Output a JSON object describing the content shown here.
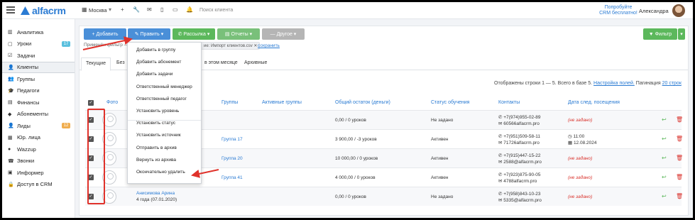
{
  "topbar": {
    "brand": "alfacrm",
    "city": "Москва",
    "search_placeholder": "Поиск клиента",
    "promo_line1": "Попробуйте",
    "promo_line2": "CRM бесплатно!",
    "user_name": "Александра"
  },
  "sidebar": {
    "items": [
      {
        "icon": "chart-icon",
        "glyph": "▥",
        "label": "Аналитика"
      },
      {
        "icon": "calendar-icon",
        "glyph": "▢",
        "label": "Уроки",
        "badge": "17",
        "badge_color": "#5bc0de"
      },
      {
        "icon": "tasks-icon",
        "glyph": "☑",
        "label": "Задачи"
      },
      {
        "icon": "user-icon",
        "glyph": "👤",
        "label": "Клиенты",
        "active": true
      },
      {
        "icon": "users-icon",
        "glyph": "👥",
        "label": "Группы"
      },
      {
        "icon": "graduation-icon",
        "glyph": "🎓",
        "label": "Педагоги"
      },
      {
        "icon": "finance-icon",
        "glyph": "▤",
        "label": "Финансы"
      },
      {
        "icon": "ticket-icon",
        "glyph": "◆",
        "label": "Абонементы"
      },
      {
        "icon": "lead-icon",
        "glyph": "👤",
        "label": "Лиды",
        "badge": "12",
        "badge_color": "#f0ad4e"
      },
      {
        "icon": "building-icon",
        "glyph": "▦",
        "label": "Юр. лица"
      },
      {
        "icon": "whatsapp-icon",
        "glyph": "●",
        "label": "Wazzup"
      },
      {
        "icon": "phone-icon",
        "glyph": "☎",
        "label": "Звонки"
      },
      {
        "icon": "monitor-icon",
        "glyph": "▣",
        "label": "Информер"
      },
      {
        "icon": "lock-icon",
        "glyph": "🔒",
        "label": "Доступ в CRM"
      }
    ]
  },
  "toolbar": {
    "add_label": "+ Добавить",
    "edit_label": "✎ Править ▾",
    "mailing_label": "✆ Рассылка ▾",
    "reports_label": "▤ Отчеты ▾",
    "other_label": "— Другое ▾",
    "filter_label": "▼ Фильтр",
    "colors": {
      "add": "#4a8fd8",
      "edit": "#4a8fd8",
      "mailing": "#5cb85c",
      "reports": "#79c07a",
      "other": "#b5b5b5",
      "filter": "#5cb85c"
    }
  },
  "filter_bar": {
    "applied_text": "Применён фильтр —",
    "chip_text": "ие: Импорт клиентов.csv ✕",
    "save_link": "сохранить"
  },
  "tabs": [
    {
      "label": "Текущие",
      "active": true
    },
    {
      "label": "Без"
    },
    {
      "label": "в этом месяце"
    },
    {
      "label": "Архивные"
    }
  ],
  "pagination": {
    "shown": "Отображены строки 1 — 5. Всего в базе 5.",
    "settings_link": "Настройка полей.",
    "pagination_label": "Пагинация",
    "per_page": "20 строк"
  },
  "table": {
    "headers": [
      "Фото",
      "Группы",
      "Активные группы",
      "Общий остаток (деньги)",
      "Статус обучения",
      "Контакты",
      "Дата след. посещения"
    ],
    "rows": [
      {
        "group": "",
        "balance": "0,00 / 0 уроков",
        "status": "Не задано",
        "phone": "✆ +7(974)955-02-89",
        "email": "✉ 60566alfacrm.pro",
        "next_1": "(не задано)",
        "next_2": ""
      },
      {
        "group": "Группа 17",
        "balance": "3 900,00 / -3 уроков",
        "status": "Активен",
        "phone": "✆ +7(951)509-58-11",
        "email": "✉ 71726alfacrm.pro",
        "next_1": "◷ 11:00",
        "next_2": "▦ 12.08.2024"
      },
      {
        "group": "Группа 20",
        "balance": "10 000,00 / 0 уроков",
        "status": "Активен",
        "phone": "✆ +7(915)447-15-22",
        "email": "✉ 2588@alfacrm.pro",
        "next_1": "(не задано)",
        "next_2": ""
      },
      {
        "group": "Группа 41",
        "balance": "4 000,00 / 0 уроков",
        "status": "Активен",
        "phone": "✆ +7(923)875-90-05",
        "email": "✉ 4788alfacrm.pro",
        "next_1": "(не задано)",
        "next_2": ""
      },
      {
        "group": "",
        "balance": "0,00 / 0 уроков",
        "status": "Не задано",
        "phone": "✆ +7(958)843-10-23",
        "email": "✉ 5335@alfacrm.pro",
        "next_1": "(не задано)",
        "next_2": "",
        "client_name": "Анисимова Арина",
        "client_age": "4 года (07.01.2020)"
      }
    ]
  },
  "edit_menu": {
    "items": [
      "Добавить в группу",
      "Добавить абонемент",
      "Добавить задачи",
      "Ответственный менеджер",
      "Ответственный педагог",
      "Установить уровень",
      "Установить статус",
      "Установить источник",
      "Отправить в архив",
      "Вернуть из архива",
      "Окончательно удалить"
    ]
  }
}
